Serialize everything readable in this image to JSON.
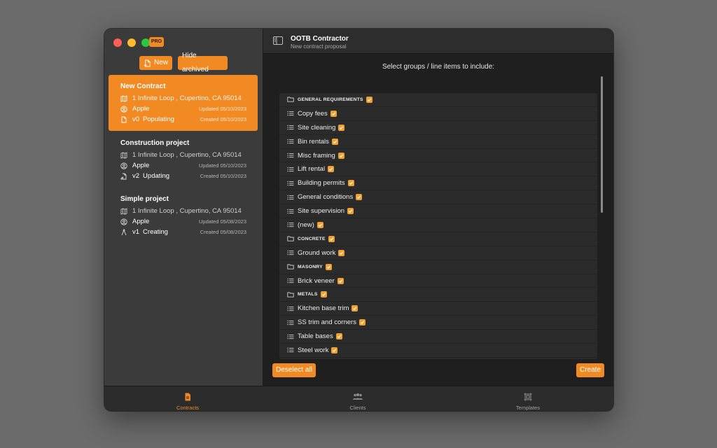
{
  "app": {
    "title": "OOTB Contractor",
    "subtitle": "New contract proposal",
    "badge": "PRO"
  },
  "sidebar": {
    "new_label": "New",
    "hide_archived_label": "Hide archived",
    "contracts": [
      {
        "title": "New Contract",
        "address": "1 Infinite Loop , Cupertino, CA 95014",
        "client": "Apple",
        "updated": "Updated 05/10/2023",
        "version": "v0",
        "status": "Populating",
        "created": "Created 05/10/2023",
        "status_icon": "document-icon"
      },
      {
        "title": "Construction project",
        "address": "1 Infinite Loop , Cupertino, CA 95014",
        "client": "Apple",
        "updated": "Updated 05/10/2023",
        "version": "v2",
        "status": "Updating",
        "created": "Created 05/10/2023",
        "status_icon": "document-edit-icon"
      },
      {
        "title": "Simple project",
        "address": "1 Infinite Loop , Cupertino, CA 95014",
        "client": "Apple",
        "updated": "Updated 05/08/2023",
        "version": "v1",
        "status": "Creating",
        "created": "Created 05/08/2023",
        "status_icon": "compass-icon"
      }
    ]
  },
  "main": {
    "prompt": "Select groups / line items to include:",
    "rows": [
      {
        "type": "group",
        "label": "GENERAL REQUIREMENTS",
        "checked": true
      },
      {
        "type": "item",
        "label": "Copy fees",
        "checked": true
      },
      {
        "type": "item",
        "label": "Site cleaning",
        "checked": true
      },
      {
        "type": "item",
        "label": "Bin rentals",
        "checked": true
      },
      {
        "type": "item",
        "label": "Misc framing",
        "checked": true
      },
      {
        "type": "item",
        "label": "Lift rental",
        "checked": true
      },
      {
        "type": "item",
        "label": "Building permits",
        "checked": true
      },
      {
        "type": "item",
        "label": "General conditions",
        "checked": true
      },
      {
        "type": "item",
        "label": "Site supervision",
        "checked": true
      },
      {
        "type": "item",
        "label": "(new)",
        "checked": true
      },
      {
        "type": "group",
        "label": "CONCRETE",
        "checked": true
      },
      {
        "type": "item",
        "label": "Ground work",
        "checked": true
      },
      {
        "type": "group",
        "label": "MASONRY",
        "checked": true
      },
      {
        "type": "item",
        "label": "Brick veneer",
        "checked": true
      },
      {
        "type": "group",
        "label": "METALS",
        "checked": true
      },
      {
        "type": "item",
        "label": "Kitchen base trim",
        "checked": true
      },
      {
        "type": "item",
        "label": "SS trim and corners",
        "checked": true
      },
      {
        "type": "item",
        "label": "Table bases",
        "checked": true
      },
      {
        "type": "item",
        "label": "Steel work",
        "checked": true
      }
    ],
    "deselect_label": "Deselect all",
    "create_label": "Create"
  },
  "tabs": [
    {
      "label": "Contracts",
      "icon": "document-icon",
      "active": true
    },
    {
      "label": "Clients",
      "icon": "people-icon",
      "active": false
    },
    {
      "label": "Templates",
      "icon": "template-icon",
      "active": false
    }
  ],
  "colors": {
    "accent": "#f28a24",
    "check": "#f0a030"
  }
}
